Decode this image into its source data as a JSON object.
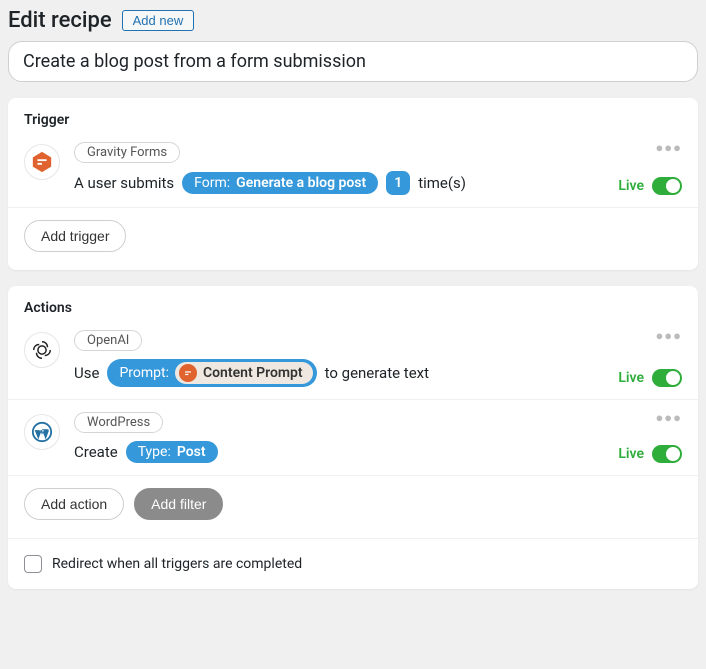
{
  "header": {
    "title": "Edit recipe",
    "add_new": "Add new"
  },
  "recipe_title": "Create a blog post from a form submission",
  "trigger": {
    "section_label": "Trigger",
    "integration": "Gravity Forms",
    "sentence": {
      "before": "A user submits",
      "pill_label": "Form:",
      "pill_value": "Generate a blog post",
      "count": "1",
      "after": "time(s)"
    },
    "status": "Live",
    "add_trigger": "Add trigger"
  },
  "actions": {
    "section_label": "Actions",
    "items": [
      {
        "integration": "OpenAI",
        "sentence": {
          "before": "Use",
          "pill_label": "Prompt:",
          "inner_value": "Content Prompt",
          "after": "to generate text"
        },
        "status": "Live"
      },
      {
        "integration": "WordPress",
        "sentence": {
          "before": "Create",
          "pill_label": "Type:",
          "pill_value": "Post"
        },
        "status": "Live"
      }
    ],
    "add_action": "Add action",
    "add_filter": "Add filter",
    "redirect_label": "Redirect when all triggers are completed"
  }
}
